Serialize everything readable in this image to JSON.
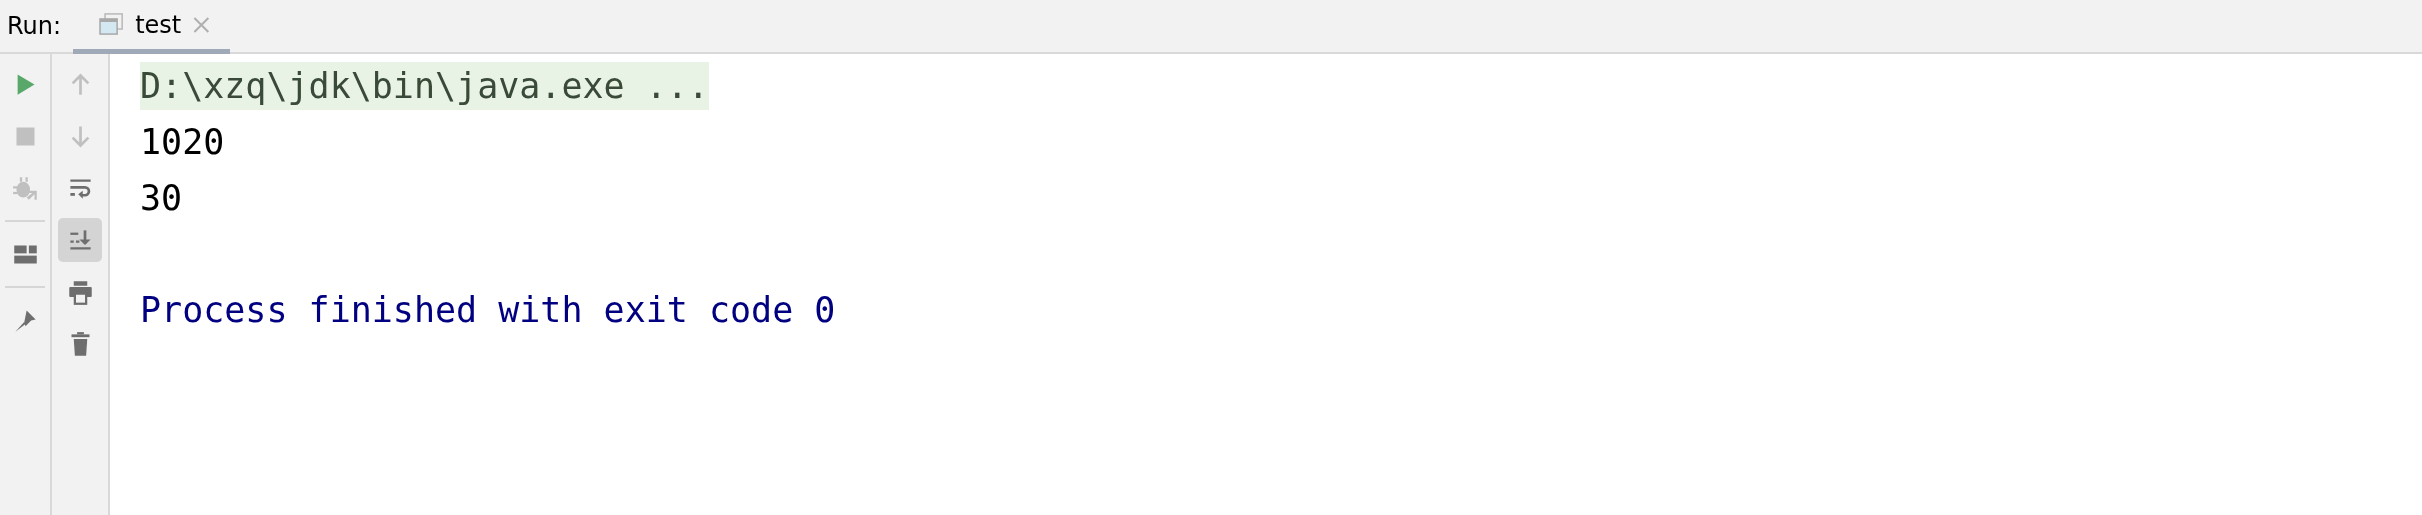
{
  "panel_title": "Run:",
  "tabs": [
    {
      "label": "test",
      "selected": true
    }
  ],
  "left_toolbar": [
    {
      "kind": "run",
      "disabled": false
    },
    {
      "kind": "stop",
      "disabled": true
    },
    {
      "kind": "debug",
      "disabled": true
    },
    {
      "kind": "separator"
    },
    {
      "kind": "layout",
      "disabled": false
    },
    {
      "kind": "separator"
    },
    {
      "kind": "pin",
      "disabled": false
    }
  ],
  "right_toolbar": [
    {
      "kind": "up",
      "disabled": true,
      "selected": false
    },
    {
      "kind": "down",
      "disabled": true,
      "selected": false
    },
    {
      "kind": "wrap",
      "disabled": false,
      "selected": false
    },
    {
      "kind": "scroll-end",
      "disabled": false,
      "selected": true
    },
    {
      "kind": "print",
      "disabled": false,
      "selected": false
    },
    {
      "kind": "trash",
      "disabled": false,
      "selected": false
    }
  ],
  "console_lines": [
    {
      "kind": "command",
      "text": "D:\\xzq\\jdk\\bin\\java.exe ..."
    },
    {
      "kind": "output",
      "text": "1020"
    },
    {
      "kind": "output",
      "text": "30"
    },
    {
      "kind": "blank"
    },
    {
      "kind": "system",
      "text": "Process finished with exit code 0"
    }
  ]
}
